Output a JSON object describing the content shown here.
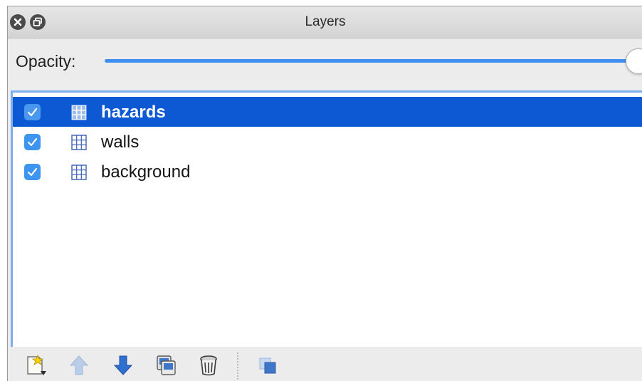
{
  "window": {
    "title": "Layers",
    "buttons": [
      "close-icon",
      "float-icon"
    ]
  },
  "opacity": {
    "label": "Opacity:",
    "value": 1.0
  },
  "layers": [
    {
      "name": "hazards",
      "visible": true,
      "selected": true,
      "icon": "tile-layer-icon"
    },
    {
      "name": "walls",
      "visible": true,
      "selected": false,
      "icon": "tile-layer-icon"
    },
    {
      "name": "background",
      "visible": true,
      "selected": false,
      "icon": "tile-layer-icon"
    }
  ],
  "toolbar": {
    "buttons": [
      {
        "icon": "new-layer-icon",
        "enabled": true
      },
      {
        "icon": "move-up-icon",
        "enabled": false
      },
      {
        "icon": "move-down-icon",
        "enabled": true
      },
      {
        "icon": "duplicate-layer-icon",
        "enabled": true
      },
      {
        "icon": "delete-layer-icon",
        "enabled": true
      },
      {
        "icon": "highlight-layer-icon",
        "enabled": true
      }
    ]
  },
  "colors": {
    "accent": "#3e8ff0",
    "selection": "#0d59d4",
    "list_border": "#7cb0ec"
  }
}
